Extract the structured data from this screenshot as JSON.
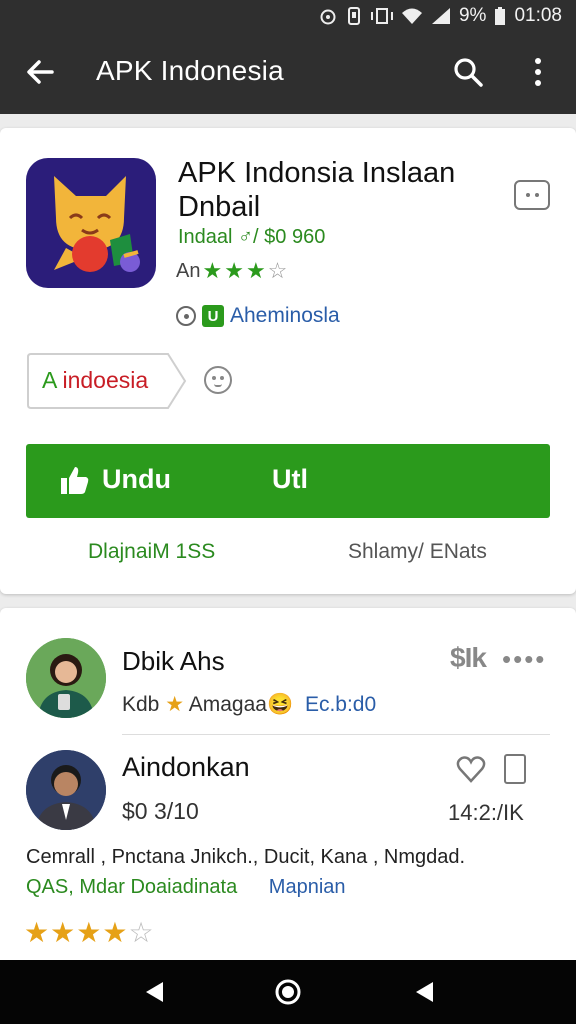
{
  "status_bar": {
    "battery": "9%",
    "time": "01:08"
  },
  "app_bar": {
    "title": "APK Indonesia"
  },
  "app": {
    "title": "APK Indonsia Inslaan Dnbail",
    "price_line": "Indaal ♂/ $0 960",
    "rating_prefix": "An",
    "rating_stars": 3,
    "rating_max": 4,
    "developer": "Aheminosla",
    "tag": {
      "prefix": "A",
      "text": "indoesia"
    },
    "install": {
      "label_left": "Undu",
      "label_right": "Utl"
    },
    "meta_left": "DlajnaiM 1SS",
    "meta_right": "Shlamy/ ENats",
    "colors": {
      "accent": "#2b9a1c",
      "bar": "#2f2f2f",
      "link": "#2a5da8"
    }
  },
  "reviews": [
    {
      "name": "Dbik Ahs",
      "prefix": "Kdb",
      "tag": "Amagaa",
      "emoji": "😆",
      "link": "Ec.b:d0",
      "code": "$Ik",
      "more": "••••"
    },
    {
      "name": "Aindonkan",
      "price": "$0 3/10",
      "count": "14:2:/IK",
      "tags_line1": "Cemrall ,  Pnctana Jnikch.,   Ducit,  Kana  ,  Nmgdad.",
      "tags_line2_green": "QAS, Mdar Doaiadinata",
      "tags_line2_blue": "Mapnian",
      "stars": 3.5,
      "max_stars": 5
    }
  ],
  "icons": {
    "back": "arrow-left-icon",
    "search": "search-icon",
    "more": "more-vertical-icon",
    "chat": "chat-icon",
    "home": "home-circle-icon"
  }
}
